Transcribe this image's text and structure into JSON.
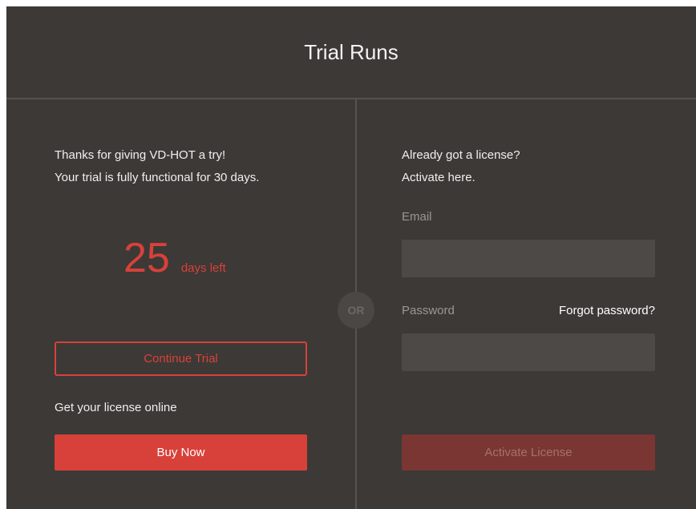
{
  "header": {
    "title": "Trial Runs"
  },
  "left": {
    "intro_line1": "Thanks for giving VD-HOT a try!",
    "intro_line2": "Your trial is fully functional for 30 days.",
    "days_left_number": "25",
    "days_left_label": "days left",
    "continue_label": "Continue Trial",
    "get_license_text": "Get your license online",
    "buy_label": "Buy Now"
  },
  "separator": {
    "or_text": "OR"
  },
  "right": {
    "intro_line1": "Already got a license?",
    "intro_line2": "Activate here.",
    "email_label": "Email",
    "email_value": "",
    "password_label": "Password",
    "password_value": "",
    "forgot_label": "Forgot password?",
    "activate_label": "Activate License"
  },
  "colors": {
    "accent": "#d8413a",
    "background": "#3c3936",
    "input_bg": "#4c4946",
    "disabled_button": "#7a3633"
  }
}
